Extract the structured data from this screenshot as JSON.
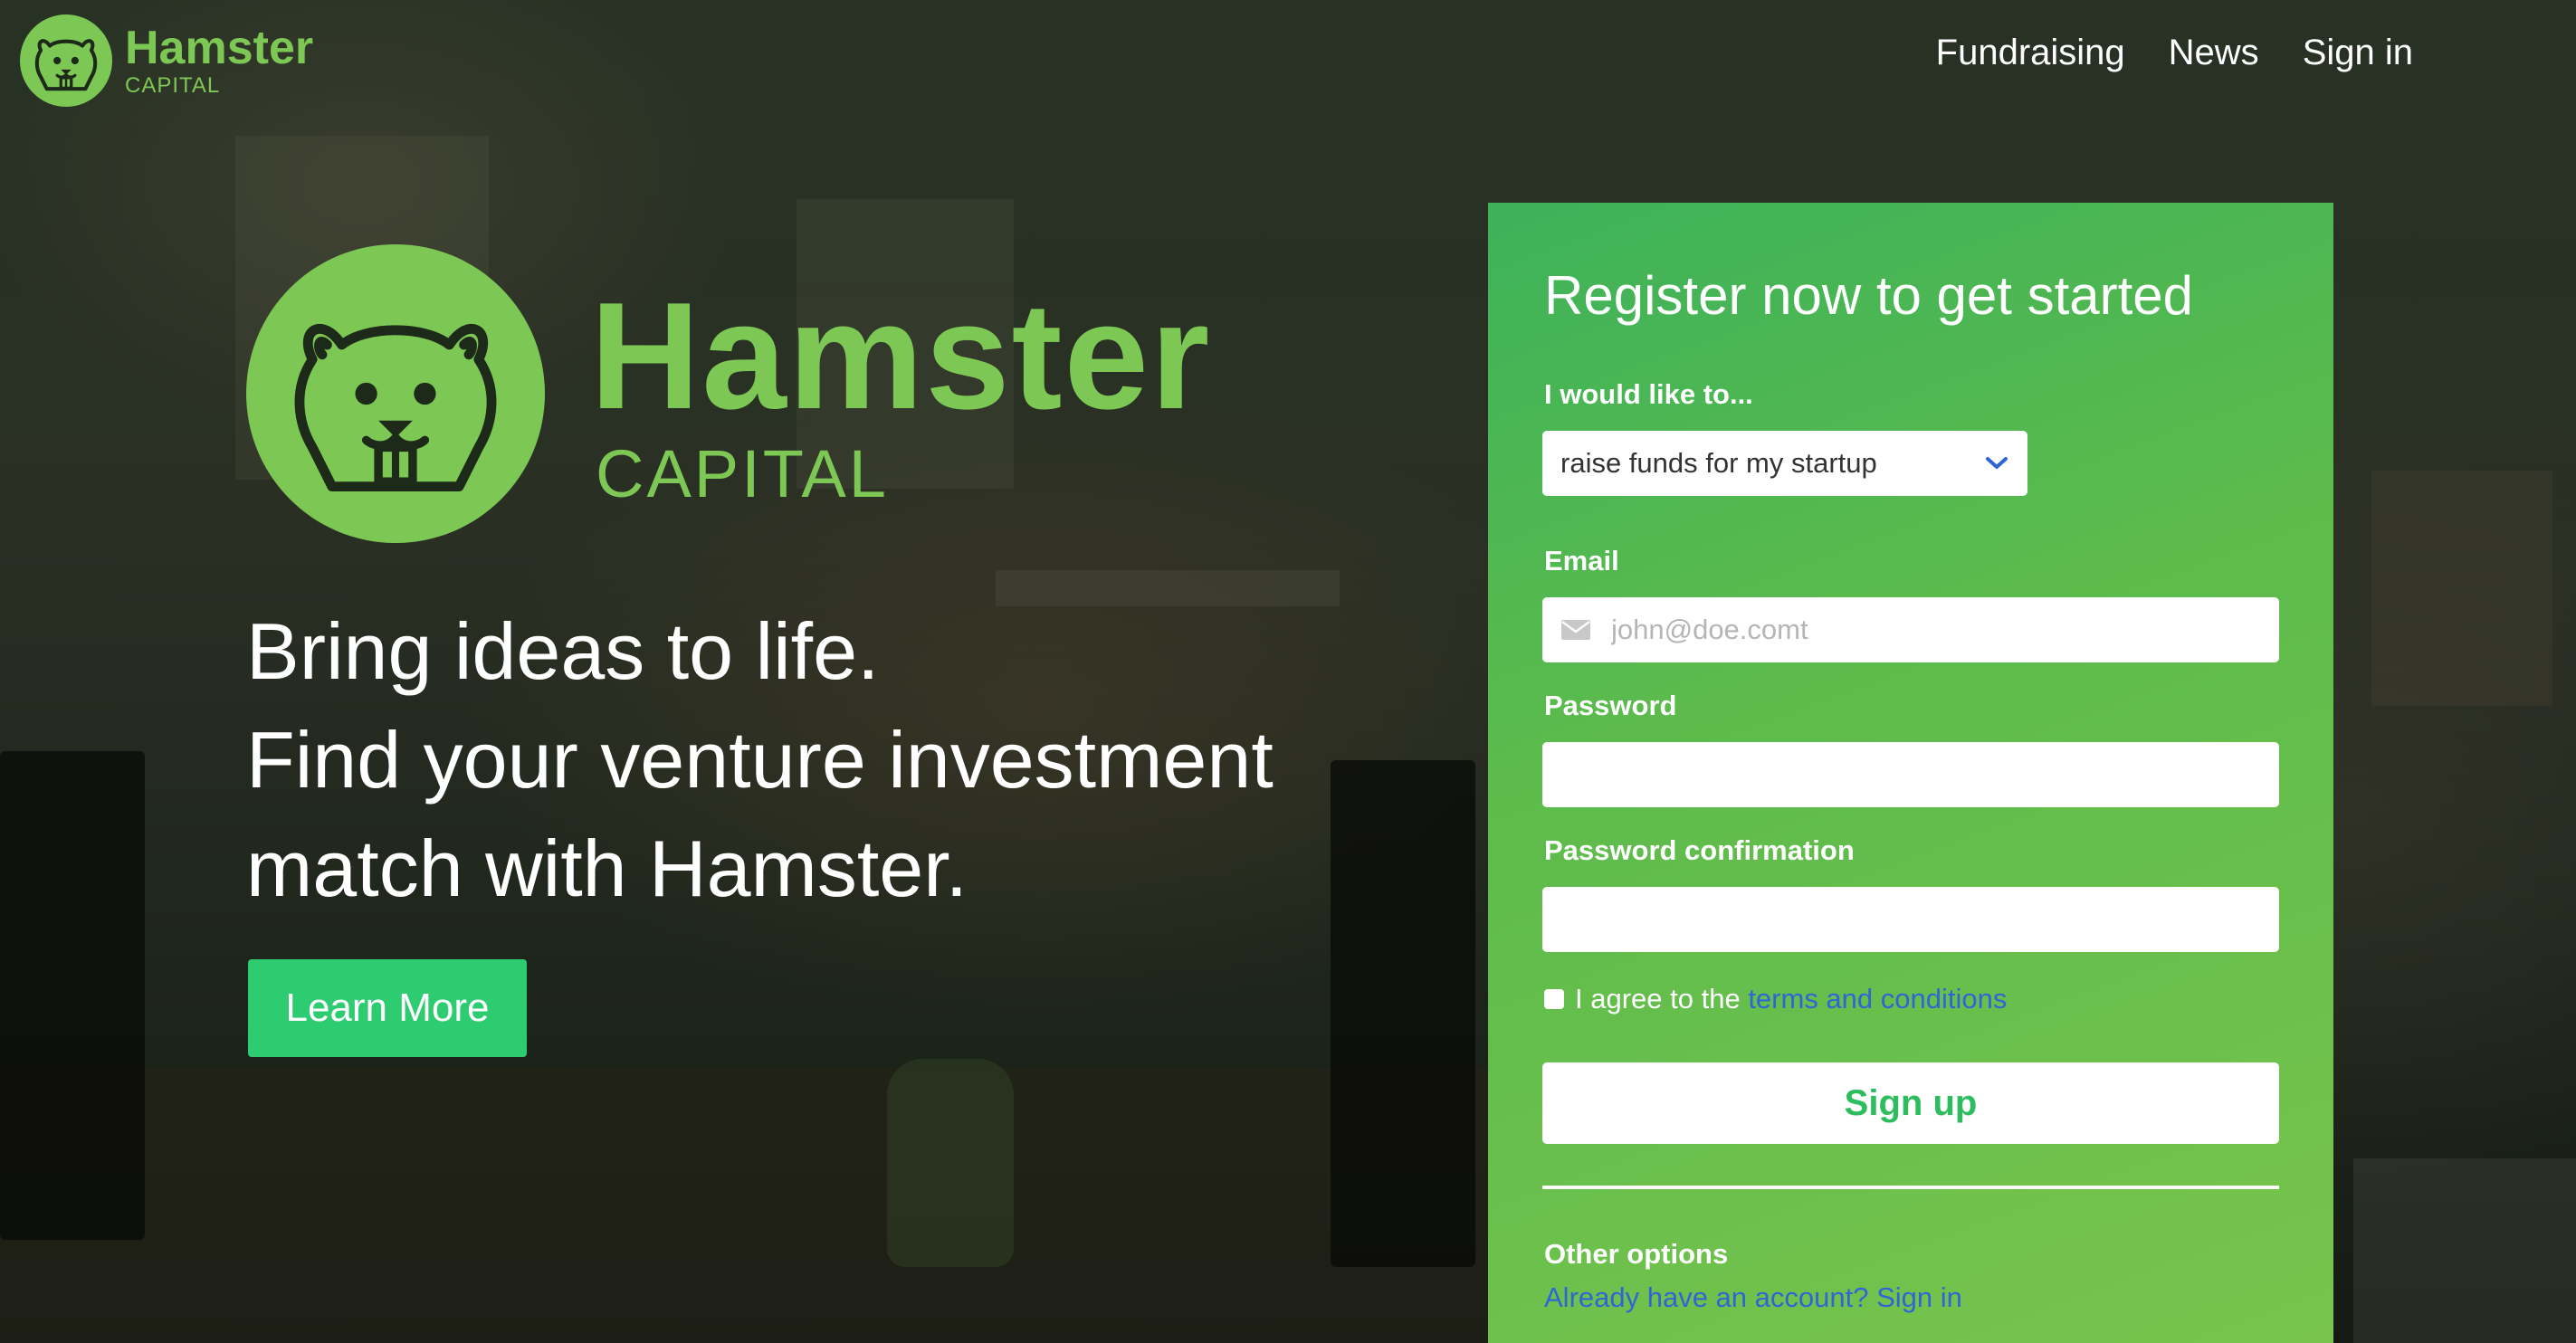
{
  "brand": {
    "name": "Hamster",
    "subtitle": "CAPITAL"
  },
  "nav": {
    "items": [
      {
        "label": "Fundraising"
      },
      {
        "label": "News"
      },
      {
        "label": "Sign in"
      }
    ]
  },
  "hero": {
    "lines": [
      "Bring ideas to life.",
      "Find your venture investment",
      "match with Hamster."
    ],
    "cta_label": "Learn More"
  },
  "register": {
    "title": "Register now to get started",
    "intent_label": "I would like to...",
    "intent_value": "raise funds for my startup",
    "email_label": "Email",
    "email_placeholder": "john@doe.comt",
    "password_label": "Password",
    "password_confirmation_label": "Password confirmation",
    "agree_prefix": "I agree to the",
    "agree_link": "terms and conditions",
    "signup_label": "Sign up",
    "other_options_label": "Other options",
    "signin_link": "Already have an account? Sign in"
  },
  "colors": {
    "brand_green": "#7dc855",
    "cta_green": "#2ecc71",
    "link_blue": "#2f66d6",
    "panel_green": "#5cbb4c"
  },
  "icons": {
    "logo": "hamster-logo-icon",
    "dropdown": "chevron-down-icon",
    "email": "mail-icon"
  }
}
